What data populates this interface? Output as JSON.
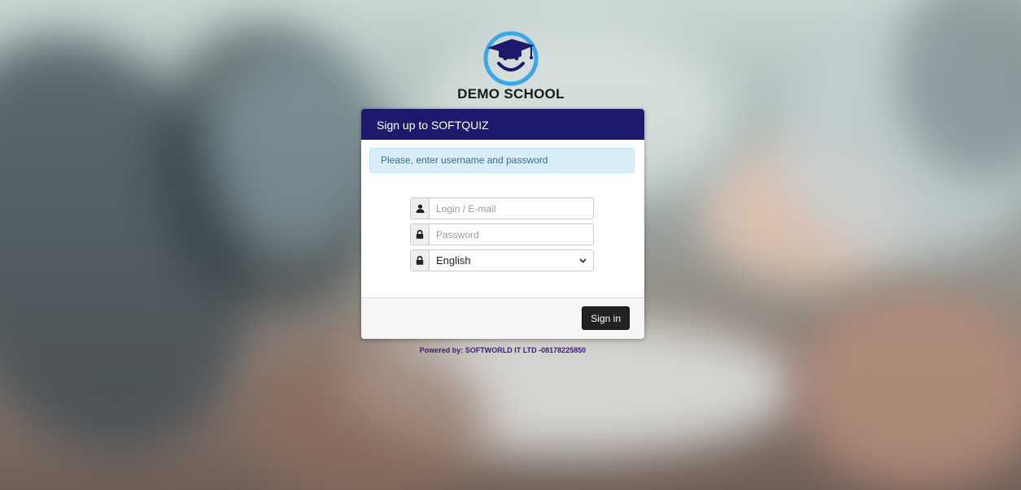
{
  "brand": {
    "school_name": "DEMO SCHOOL",
    "colors": {
      "header": "#1d1a6e",
      "logo_ring": "#3aa7e8",
      "logo_cap": "#1d1a6e"
    },
    "logo_icon": "graduation-cap-smiley-icon"
  },
  "panel": {
    "title": "Sign up to SOFTQUIZ",
    "alert": "Please, enter username and password"
  },
  "form": {
    "login_placeholder": "Login / E-mail",
    "login_icon": "user-icon",
    "password_placeholder": "Password",
    "password_icon": "lock-icon",
    "language_value": "English",
    "language_icon": "lock-icon",
    "submit_label": "Sign in"
  },
  "footer": {
    "powered_by": "Powered by: SOFTWORLD IT LTD -08178225850"
  }
}
